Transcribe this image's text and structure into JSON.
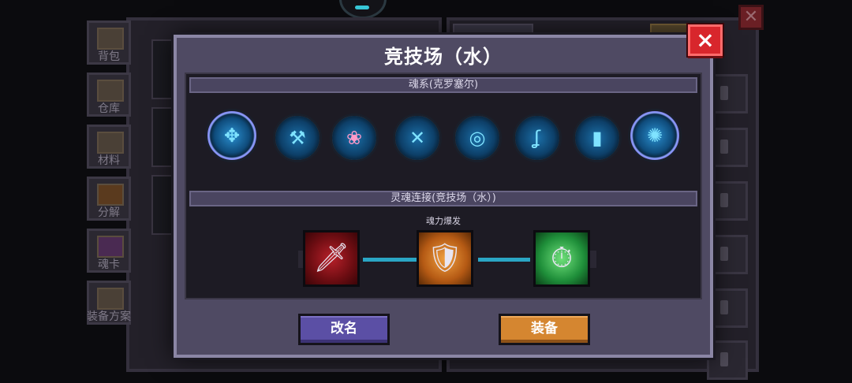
{
  "background": {
    "sidebar_tabs": [
      {
        "label": "背包",
        "icon": "backpack-icon"
      },
      {
        "label": "仓库",
        "icon": "warehouse-icon"
      },
      {
        "label": "材料",
        "icon": "materials-icon"
      },
      {
        "label": "分解",
        "icon": "decompose-icon"
      },
      {
        "label": "魂卡",
        "icon": "soul-card-icon"
      },
      {
        "label": "装备方案",
        "icon": "equipment-plan-icon"
      }
    ]
  },
  "modal": {
    "title": "竞技场（水）",
    "close_icon": "×",
    "soul_section": {
      "header": "魂系(克罗塞尔)",
      "icons": [
        {
          "name": "ornate-water-swirl-icon",
          "glyph": "✥"
        },
        {
          "name": "blue-axe-orb-icon",
          "glyph": "⚒"
        },
        {
          "name": "pink-shell-orb-icon",
          "glyph": "❀"
        },
        {
          "name": "crossed-tools-orb-icon",
          "glyph": "✕"
        },
        {
          "name": "ring-orb-icon",
          "glyph": "◎"
        },
        {
          "name": "hook-glyph-orb-icon",
          "glyph": "ʆ"
        },
        {
          "name": "shield-orb-icon",
          "glyph": "▮"
        },
        {
          "name": "ornate-skull-crest-icon",
          "glyph": "✺"
        }
      ]
    },
    "link_section": {
      "header": "灵魂连接(竞技场（水）)",
      "connector_label": "魂力爆发",
      "cards": [
        {
          "name": "red-dagger-card-icon",
          "glyph": "🗡"
        },
        {
          "name": "orange-shield-card-icon",
          "glyph": "🛡"
        },
        {
          "name": "green-clock-card-icon",
          "glyph": "⏱"
        }
      ]
    },
    "buttons": {
      "rename": "改名",
      "equip": "装备"
    }
  },
  "colors": {
    "accent_link": "#2aa6c4",
    "close_red": "#d8262c",
    "rename_purple": "#5b4fa5",
    "equip_orange": "#d58630"
  }
}
